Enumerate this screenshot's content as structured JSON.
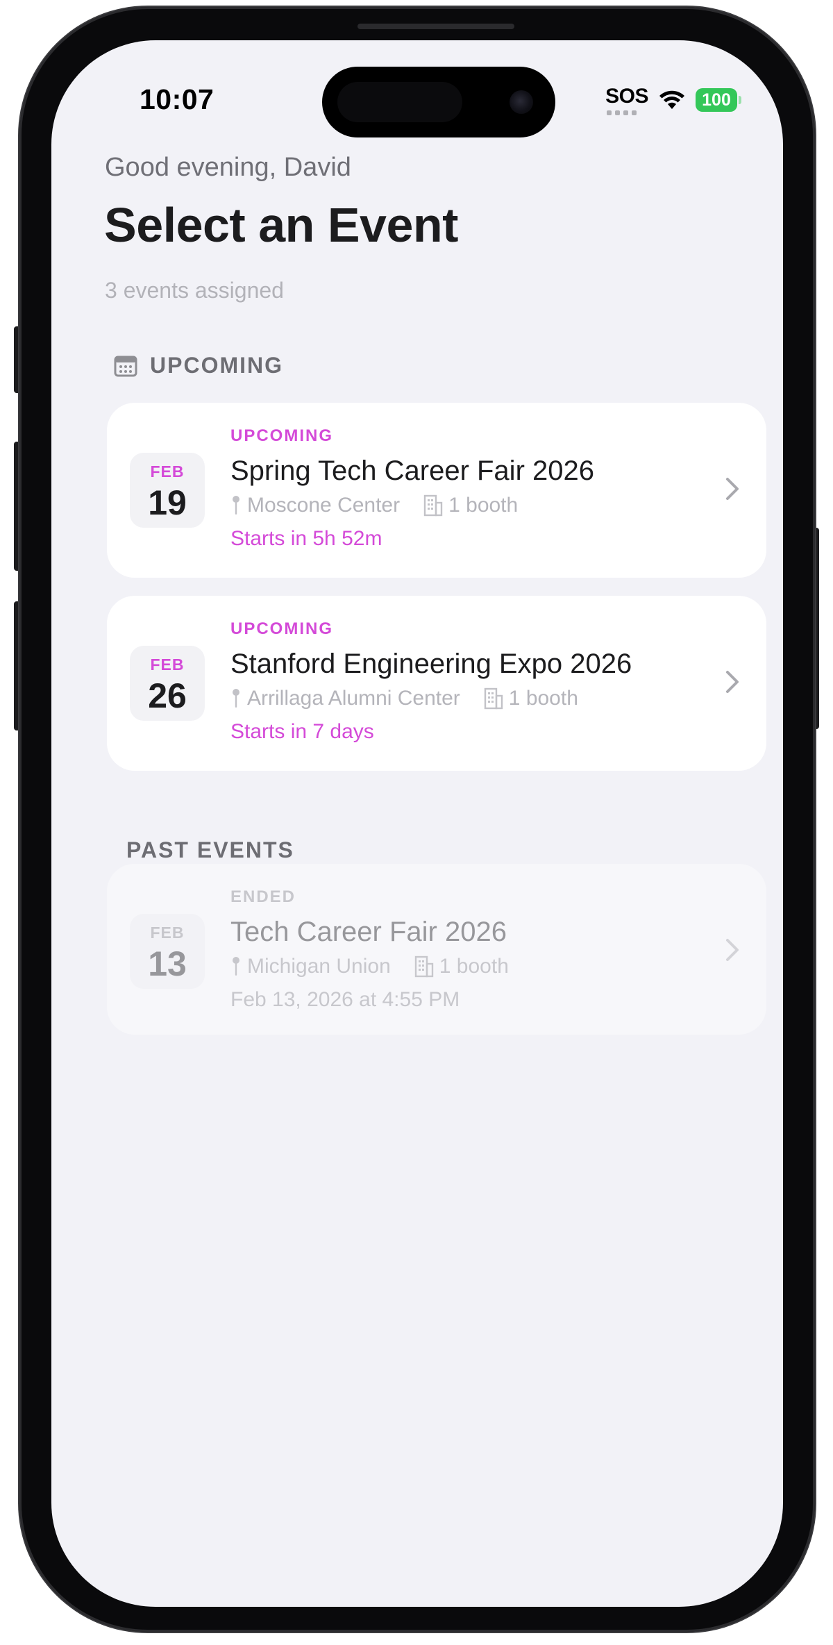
{
  "status_bar": {
    "time": "10:07",
    "sos": "SOS",
    "battery": "100"
  },
  "header": {
    "greeting": "Good evening, David",
    "title": "Select an Event",
    "subtitle": "3 events assigned"
  },
  "sections": {
    "upcoming_label": "UPCOMING",
    "past_label": "PAST EVENTS"
  },
  "events": [
    {
      "month": "FEB",
      "day": "19",
      "status": "UPCOMING",
      "name": "Spring Tech Career Fair 2026",
      "location": "Moscone Center",
      "booths": "1 booth",
      "time_info": "Starts in 5h 52m"
    },
    {
      "month": "FEB",
      "day": "26",
      "status": "UPCOMING",
      "name": "Stanford Engineering Expo 2026",
      "location": "Arrillaga Alumni Center",
      "booths": "1 booth",
      "time_info": "Starts in 7 days"
    },
    {
      "month": "FEB",
      "day": "13",
      "status": "ENDED",
      "name": "Tech Career Fair 2026",
      "location": "Michigan Union",
      "booths": "1 booth",
      "time_info": "Feb 13, 2026 at 4:55 PM"
    }
  ],
  "colors": {
    "accent": "#d44ad8",
    "background": "#f2f2f7",
    "battery": "#34c759"
  },
  "icons": [
    "calendar-icon",
    "pin-icon",
    "building-icon",
    "chevron-right-icon",
    "wifi-icon",
    "battery-icon"
  ]
}
